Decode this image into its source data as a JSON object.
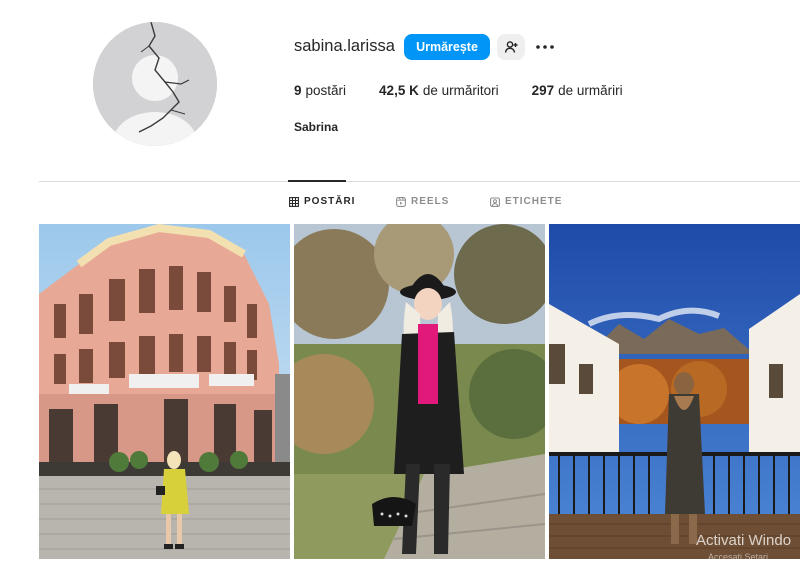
{
  "profile": {
    "username": "sabina.larissa",
    "follow_label": "Urmărește",
    "full_name": "Sabrina",
    "stats": {
      "posts_count": "9",
      "posts_label": "postări",
      "followers_count": "42,5 K",
      "followers_label": "de urmăritori",
      "following_count": "297",
      "following_label": "de urmăriri"
    }
  },
  "tabs": [
    {
      "label": "POSTĂRI",
      "icon": "grid-icon",
      "active": true
    },
    {
      "label": "REELS",
      "icon": "reels-icon",
      "active": false
    },
    {
      "label": "ETICHETE",
      "icon": "tagged-icon",
      "active": false
    }
  ],
  "posts": [
    {
      "icon": "photo-building-street"
    },
    {
      "icon": "photo-autumn-park"
    },
    {
      "icon": "photo-mountain-balcony"
    }
  ],
  "os_overlay": {
    "watermark": "Activati Windo",
    "watermark_sub": "Accesati Setari"
  },
  "colors": {
    "accent": "#0095f6",
    "text": "#262626",
    "muted": "#8e8e8e",
    "divider": "#dbdbdb"
  }
}
